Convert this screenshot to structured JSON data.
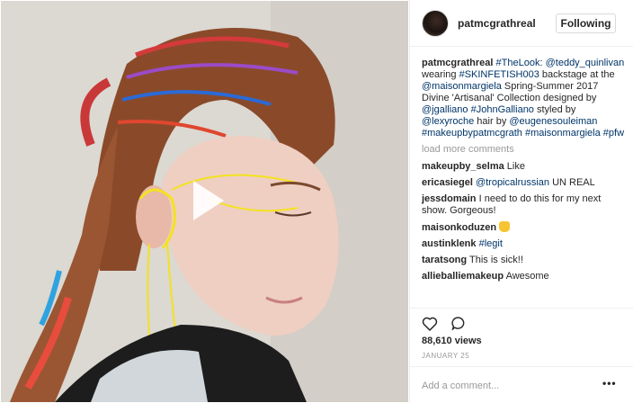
{
  "post": {
    "username": "patmcgrathreal",
    "follow_label": "Following",
    "caption": {
      "author": "patmcgrathreal",
      "parts": [
        {
          "text": "#TheLook",
          "link": true
        },
        {
          "text": ": ",
          "link": false
        },
        {
          "text": "@teddy_quinlivan",
          "link": true
        },
        {
          "text": " wearing ",
          "link": false
        },
        {
          "text": "#SKINFETISH003",
          "link": true
        },
        {
          "text": " backstage at the ",
          "link": false
        },
        {
          "text": "@maisonmargiela",
          "link": true
        },
        {
          "text": " Spring-Summer 2017 Divine 'Artisanal' Collection designed by ",
          "link": false
        },
        {
          "text": "@jgalliano",
          "link": true
        },
        {
          "text": " ",
          "link": false
        },
        {
          "text": "#JohnGalliano",
          "link": true
        },
        {
          "text": " styled by ",
          "link": false
        },
        {
          "text": "@lexyroche",
          "link": true
        },
        {
          "text": " hair by ",
          "link": false
        },
        {
          "text": "@eugenesouleiman",
          "link": true
        },
        {
          "text": " ",
          "link": false
        },
        {
          "text": "#makeupbypatmcgrath",
          "link": true
        },
        {
          "text": " ",
          "link": false
        },
        {
          "text": "#maisonmargiela",
          "link": true
        },
        {
          "text": " ",
          "link": false
        },
        {
          "text": "#pfw",
          "link": true
        }
      ]
    },
    "load_more": "load more comments",
    "comments": [
      {
        "user": "makeupby_selma",
        "parts": [
          {
            "text": "Like",
            "link": false
          }
        ]
      },
      {
        "user": "ericasiegel",
        "parts": [
          {
            "text": "@tropicalrussian",
            "link": true
          },
          {
            "text": " UN REAL",
            "link": false
          }
        ]
      },
      {
        "user": "jessdomain",
        "parts": [
          {
            "text": "I need to do this for my next show. Gorgeous!",
            "link": false
          }
        ]
      },
      {
        "user": "maisonkoduzen",
        "parts": [
          {
            "text": "",
            "link": false
          }
        ],
        "emoji": "thumbs-up"
      },
      {
        "user": "austinklenk",
        "parts": [
          {
            "text": "#legit",
            "link": true
          }
        ]
      },
      {
        "user": "taratsong",
        "parts": [
          {
            "text": "This is sick!!",
            "link": false
          }
        ]
      },
      {
        "user": "allieballiemakeup",
        "parts": [
          {
            "text": "Awesome",
            "link": false
          }
        ]
      }
    ],
    "views": "88,610 views",
    "date": "JANUARY 25",
    "add_comment_placeholder": "Add a comment...",
    "more_label": "•••",
    "colors": {
      "link": "#003569",
      "text": "#262626",
      "muted": "#999999",
      "border": "#efefef"
    },
    "icons": {
      "like": "heart-outline-icon",
      "comment": "comment-bubble-icon",
      "play": "play-icon",
      "more": "more-options-icon"
    }
  }
}
